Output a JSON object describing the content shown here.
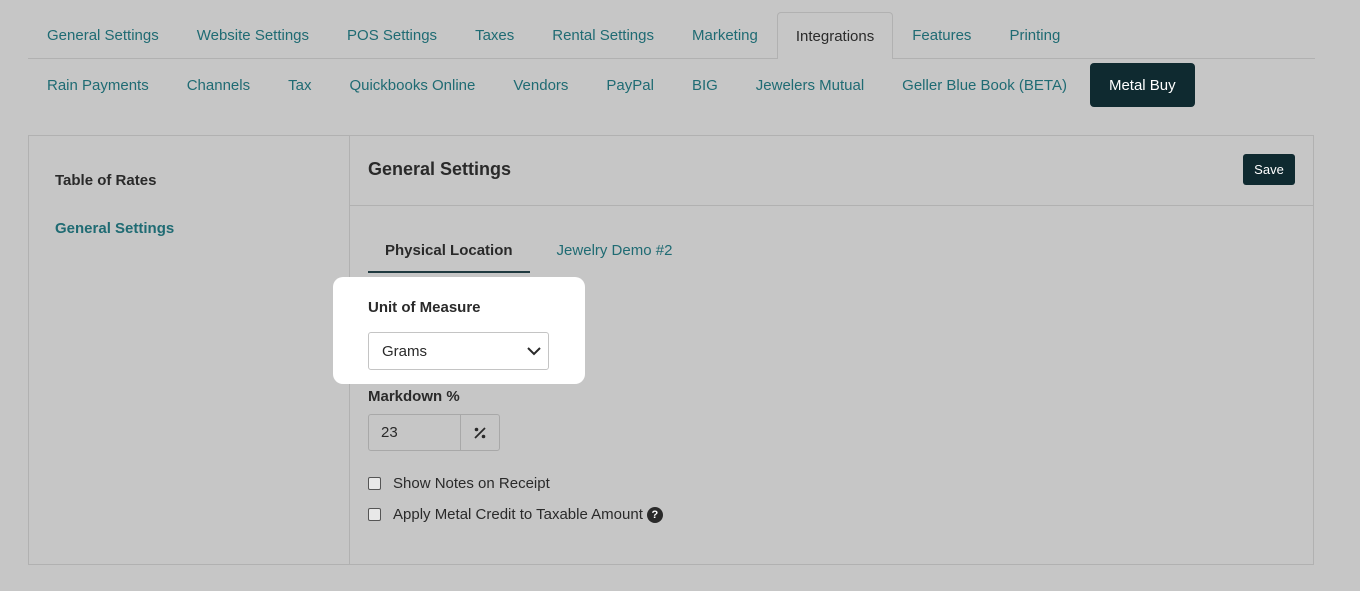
{
  "top_tabs": [
    {
      "label": "General Settings",
      "active": false
    },
    {
      "label": "Website Settings",
      "active": false
    },
    {
      "label": "POS Settings",
      "active": false
    },
    {
      "label": "Taxes",
      "active": false
    },
    {
      "label": "Rental Settings",
      "active": false
    },
    {
      "label": "Marketing",
      "active": false
    },
    {
      "label": "Integrations",
      "active": true
    },
    {
      "label": "Features",
      "active": false
    },
    {
      "label": "Printing",
      "active": false
    }
  ],
  "sub_tabs": [
    {
      "label": "Rain Payments",
      "active": false
    },
    {
      "label": "Channels",
      "active": false
    },
    {
      "label": "Tax",
      "active": false
    },
    {
      "label": "Quickbooks Online",
      "active": false
    },
    {
      "label": "Vendors",
      "active": false
    },
    {
      "label": "PayPal",
      "active": false
    },
    {
      "label": "BIG",
      "active": false
    },
    {
      "label": "Jewelers Mutual",
      "active": false
    },
    {
      "label": "Geller Blue Book (BETA)",
      "active": false
    },
    {
      "label": "Metal Buy",
      "active": true
    }
  ],
  "sidebar": {
    "items": [
      {
        "label": "Table of Rates"
      },
      {
        "label": "General Settings"
      }
    ]
  },
  "main": {
    "title": "General Settings",
    "save_label": "Save",
    "location_tabs": [
      {
        "label": "Physical Location",
        "active": true
      },
      {
        "label": "Jewelry Demo #2",
        "active": false
      }
    ],
    "unit_of_measure": {
      "label": "Unit of Measure",
      "value": "Grams"
    },
    "markdown": {
      "label": "Markdown %",
      "value": "23"
    },
    "checkboxes": [
      {
        "label": "Show Notes on Receipt",
        "checked": false
      },
      {
        "label": "Apply Metal Credit to Taxable Amount",
        "checked": false,
        "help": "?"
      }
    ]
  },
  "colors": {
    "background": "#c6c6c6",
    "accent_text": "#1f6b73",
    "dark_button": "#0f2a30"
  }
}
